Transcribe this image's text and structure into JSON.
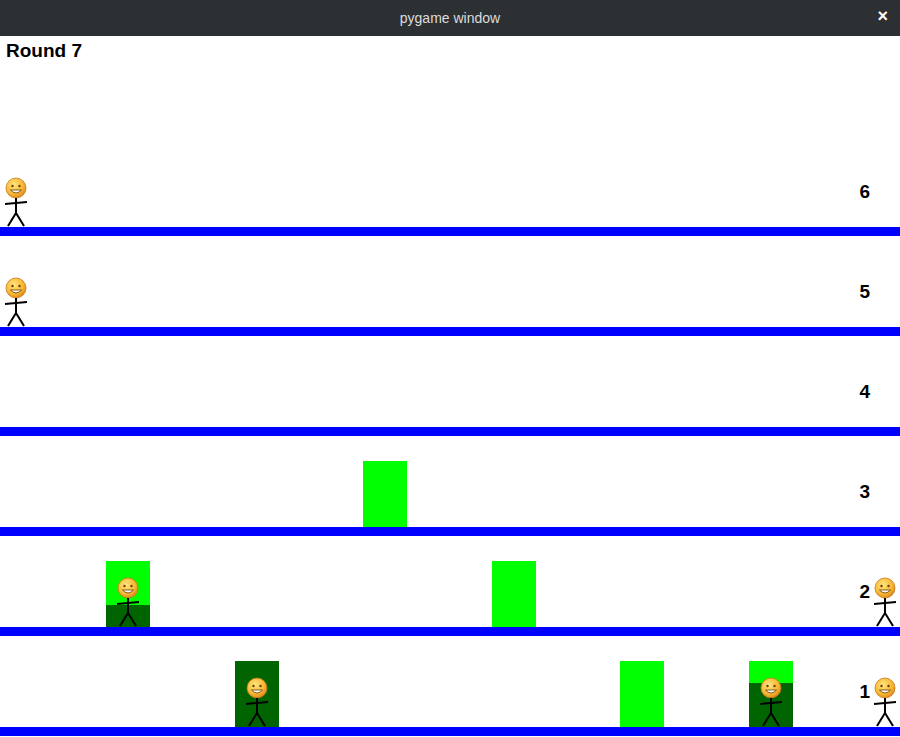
{
  "window": {
    "title": "pygame window",
    "close": "×"
  },
  "round": "Round 7",
  "floors": [
    {
      "label": "6",
      "walkers": 1,
      "boxes": []
    },
    {
      "label": "5",
      "walkers": 1,
      "boxes": []
    },
    {
      "label": "4",
      "walkers": 0,
      "boxes": []
    },
    {
      "label": "3",
      "walkers": 0,
      "boxes": [
        {
          "level": 0,
          "occupied": false
        }
      ]
    },
    {
      "label": "2",
      "walkers": 1,
      "boxes": [
        {
          "level": 0.33,
          "occupied": true
        },
        {
          "level": 0,
          "occupied": false
        }
      ]
    },
    {
      "label": "1",
      "walkers": 1,
      "boxes": [
        {
          "level": 1,
          "occupied": true
        },
        {
          "level": 0,
          "occupied": false
        },
        {
          "level": 0.67,
          "occupied": true
        }
      ]
    }
  ]
}
